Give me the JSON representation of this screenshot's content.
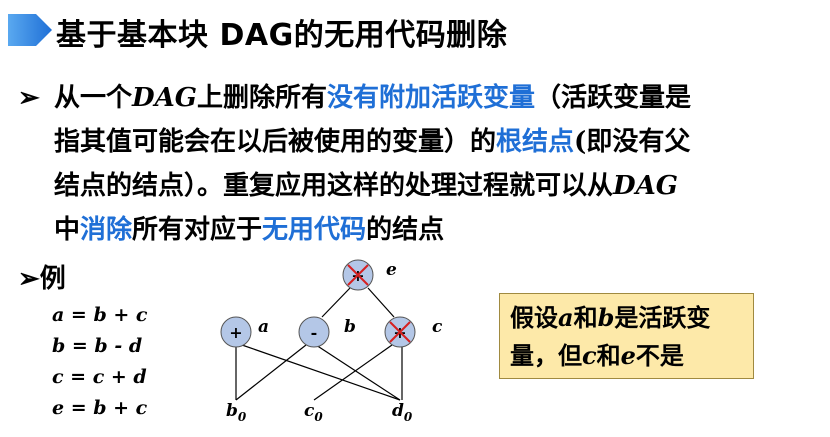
{
  "title": "基于基本块 DAG的无用代码删除",
  "para": {
    "l1a": "从一个",
    "l1b": "DAG",
    "l1c": "上删除所有",
    "l1d": "没有附加活跃变量",
    "l1e": "（活跃变量是",
    "l2a": "指其值可能会在以后被使用的变量）的",
    "l2b": "根结点",
    "l2c": "(即没有父",
    "l3a": "结点的结点）。重复应用这样的处理过程就可以从",
    "l3b": "DAG",
    "l4a": "中",
    "l4b": "消除",
    "l4c": "所有对应于",
    "l4d": "无用代码",
    "l4e": "的结点"
  },
  "example_label": "例",
  "equations": [
    "a = b + c",
    "b = b - d",
    "c = c + d",
    "e = b + c"
  ],
  "dag": {
    "root": {
      "op": "+",
      "label": "e"
    },
    "mid": [
      {
        "op": "+",
        "label": "a"
      },
      {
        "op": "-",
        "label": "b"
      },
      {
        "op": "+",
        "label": "c"
      }
    ],
    "leaves": [
      {
        "base": "b",
        "sub": "0"
      },
      {
        "base": "c",
        "sub": "0"
      },
      {
        "base": "d",
        "sub": "0"
      }
    ]
  },
  "note": {
    "t1": "假设",
    "t2": "a",
    "t3": "和",
    "t4": "b",
    "t5": "是活跃变",
    "t6": "量，但",
    "t7": "c",
    "t8": "和",
    "t9": "e",
    "t10": "不是"
  },
  "colors": {
    "accent": "#1f6fd6",
    "node_fill": "#b4c7e7",
    "note_bg": "#fde9a9",
    "cross": "#d62020"
  }
}
